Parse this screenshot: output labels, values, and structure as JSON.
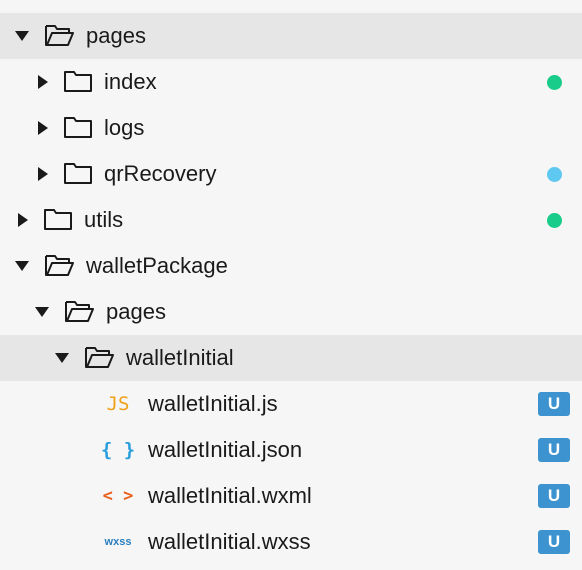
{
  "colors": {
    "row_selected": "#e6e6e6",
    "status_green": "#19cc8a",
    "status_blue": "#5fc8f0",
    "badge_untracked": "#3d93cf",
    "js_icon": "#f0a01a",
    "json_icon": "#2a9fdc",
    "wxml_icon": "#e8601c",
    "wxss_icon": "#2a7fbf"
  },
  "tree": {
    "pages": {
      "label": "pages",
      "state": "expanded"
    },
    "index": {
      "label": "index",
      "state": "collapsed",
      "status": "green"
    },
    "logs": {
      "label": "logs",
      "state": "collapsed"
    },
    "qrRecovery": {
      "label": "qrRecovery",
      "state": "collapsed",
      "status": "blue"
    },
    "utils": {
      "label": "utils",
      "state": "collapsed",
      "status": "green"
    },
    "walletPackage": {
      "label": "walletPackage",
      "state": "expanded"
    },
    "walletPackage_pages": {
      "label": "pages",
      "state": "expanded"
    },
    "walletInitial": {
      "label": "walletInitial",
      "state": "expanded"
    },
    "files": [
      {
        "label": "walletInitial.js",
        "icon": "js-file-icon",
        "icon_text": "JS",
        "badge": "U"
      },
      {
        "label": "walletInitial.json",
        "icon": "json-file-icon",
        "icon_text": "{ }",
        "badge": "U"
      },
      {
        "label": "walletInitial.wxml",
        "icon": "wxml-file-icon",
        "icon_text": "< >",
        "badge": "U"
      },
      {
        "label": "walletInitial.wxss",
        "icon": "wxss-file-icon",
        "icon_text": "wxss",
        "badge": "U"
      }
    ]
  }
}
